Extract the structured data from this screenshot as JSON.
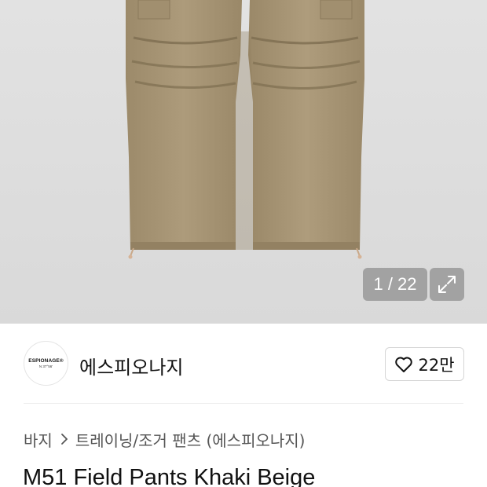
{
  "gallery": {
    "counter_text": "1 / 22",
    "current_index": 1,
    "total_images": 22,
    "background_color": "#dedede",
    "product_color": "#a89676"
  },
  "brand": {
    "logo_line1": "ESPIONAGE®",
    "logo_line2": "N 37°56'",
    "name": "에스피오나지"
  },
  "like": {
    "count": "22만",
    "icon": "heart-outline-icon"
  },
  "breadcrumb": {
    "category": "바지",
    "subcategory": "트레이닝/조거 팬츠 (에스피오나지)",
    "separator_icon": "chevron-right-icon"
  },
  "product": {
    "title": "M51 Field Pants Khaki Beige"
  }
}
